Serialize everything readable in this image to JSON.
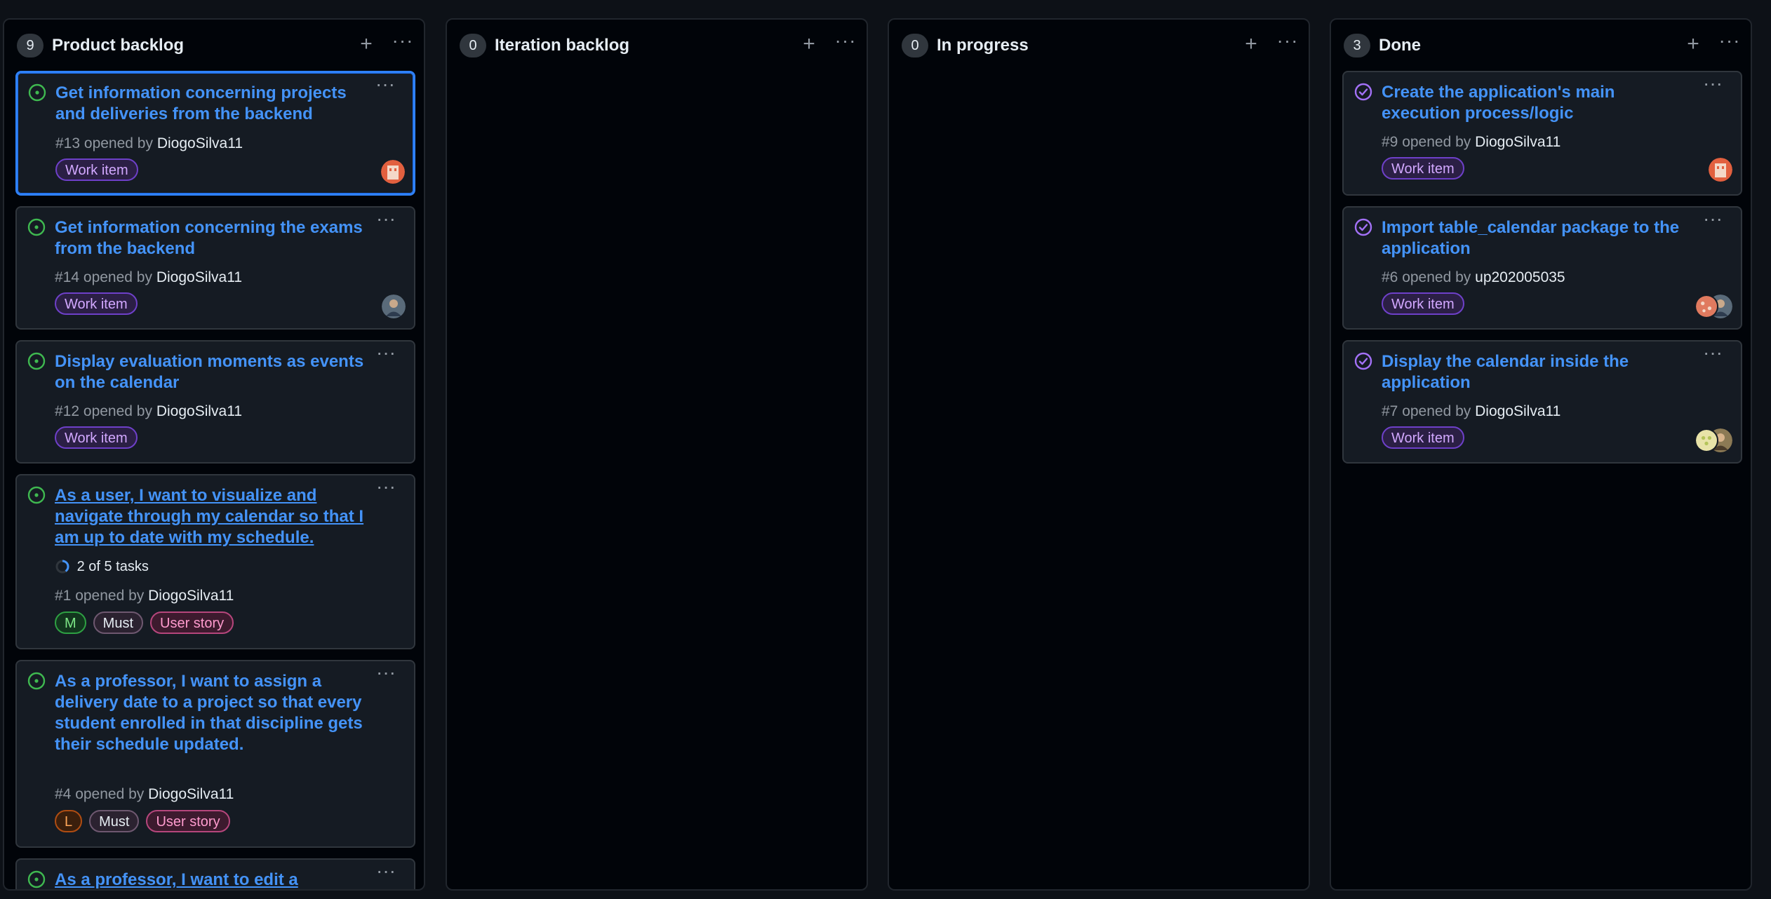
{
  "columns": [
    {
      "count": "9",
      "title": "Product backlog",
      "cards": [
        {
          "title": "Get information concerning projects and deliveries from the backend",
          "number": "#13",
          "opened_by": "opened by",
          "author": "DiogoSilva11",
          "labels": [
            "Work item"
          ],
          "selected": true,
          "avatar": "avatar-orange-icon"
        },
        {
          "title": "Get information concerning the exams from the backend",
          "number": "#14",
          "opened_by": "opened by",
          "author": "DiogoSilva11",
          "labels": [
            "Work item"
          ],
          "avatar": "avatar-photo-icon"
        },
        {
          "title": "Display evaluation moments as events on the calendar",
          "number": "#12",
          "opened_by": "opened by",
          "author": "DiogoSilva11",
          "labels": [
            "Work item"
          ]
        },
        {
          "title": "As a user, I want to visualize and navigate through my calendar so that I am up to date with my schedule.",
          "tasks": "2 of 5 tasks",
          "tasks_done": 2,
          "tasks_total": 5,
          "number": "#1",
          "opened_by": "opened by",
          "author": "DiogoSilva11",
          "labels": [
            "M",
            "Must",
            "User story"
          ]
        },
        {
          "title": "As a professor, I want to assign a delivery date to a project so that every student enrolled in that discipline gets their schedule updated.",
          "number": "#4",
          "opened_by": "opened by",
          "author": "DiogoSilva11",
          "labels": [
            "L",
            "Must",
            "User story"
          ]
        },
        {
          "title": "As a professor, I want to edit a"
        }
      ]
    },
    {
      "count": "0",
      "title": "Iteration backlog",
      "cards": []
    },
    {
      "count": "0",
      "title": "In progress",
      "cards": []
    },
    {
      "count": "3",
      "title": "Done",
      "cards": [
        {
          "title": "Create the application's main execution process/logic",
          "number": "#9",
          "opened_by": "opened by",
          "author": "DiogoSilva11",
          "labels": [
            "Work item"
          ],
          "avatar": "avatar-orange-icon"
        },
        {
          "title": "Import table_calendar package to the application",
          "number": "#6",
          "opened_by": "opened by",
          "author": "up202005035",
          "labels": [
            "Work item"
          ],
          "avatar": "avatar-pair-icon"
        },
        {
          "title": "Display the calendar inside the application",
          "number": "#7",
          "opened_by": "opened by",
          "author": "DiogoSilva11",
          "labels": [
            "Work item"
          ],
          "avatar": "avatar-pair-icon"
        }
      ]
    }
  ],
  "icons": {
    "add": "+",
    "more": "···",
    "open_issue": "issue-open-icon",
    "closed_issue": "issue-closed-icon"
  },
  "colors": {
    "link": "#4493f8",
    "open": "#3fb950",
    "closed": "#a371f7",
    "selected_border": "#2f81f7"
  }
}
